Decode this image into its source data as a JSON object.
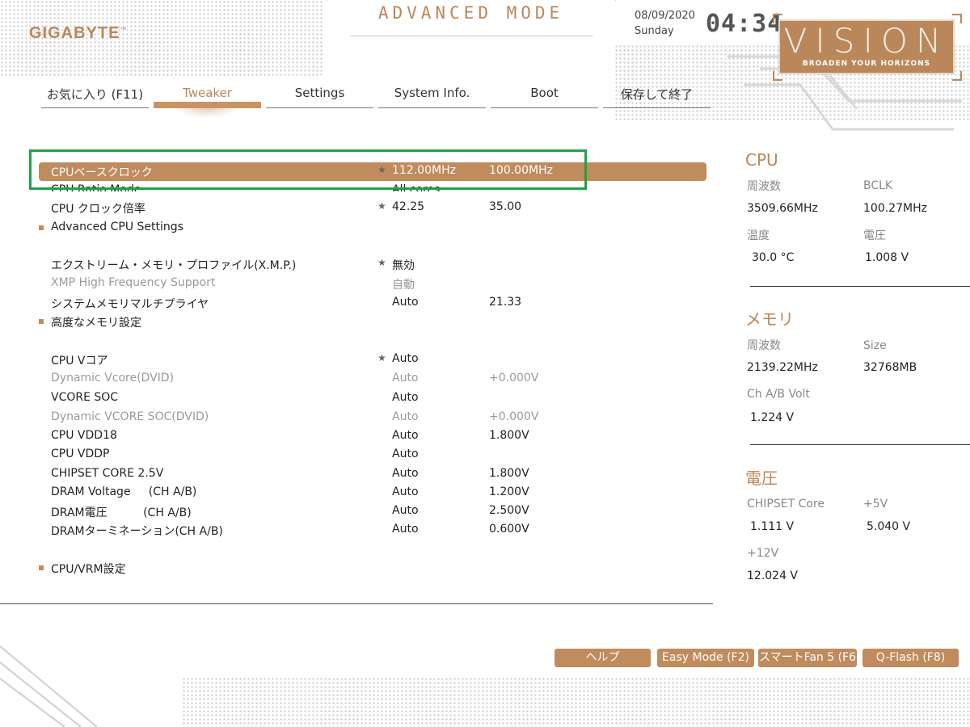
{
  "header": {
    "logo": "GIGABYTE",
    "mode": "ADVANCED MODE",
    "date": "08/09/2020",
    "day": "Sunday",
    "time": "04:34",
    "vision_title": "VISION",
    "vision_tagline": "BROADEN YOUR HORIZONS"
  },
  "tabs": [
    {
      "label": "お気に入り (F11)",
      "active": false
    },
    {
      "label": "Tweaker",
      "active": true
    },
    {
      "label": "Settings",
      "active": false
    },
    {
      "label": "System Info.",
      "active": false
    },
    {
      "label": "Boot",
      "active": false
    },
    {
      "label": "保存して終了",
      "active": false
    }
  ],
  "settings": [
    {
      "label": "CPUベースクロック",
      "star": "★",
      "v1": "112.00MHz",
      "v2": "100.00MHz",
      "selected": true
    },
    {
      "label": "CPU Ratio Mode",
      "v1": "All cores",
      "v2": ""
    },
    {
      "label": "CPU クロック倍率",
      "star": "★",
      "v1": "42.25",
      "v2": "35.00"
    },
    {
      "label": "Advanced CPU Settings",
      "bullet": true
    },
    {
      "label": "エクストリーム・メモリ・プロファイル(X.M.P.)",
      "star": "★",
      "v1": "無効",
      "v2": ""
    },
    {
      "label": "XMP High Frequency Support",
      "v1": "自動",
      "v2": "",
      "dim": true
    },
    {
      "label": "システムメモリマルチプライヤ",
      "v1": "Auto",
      "v2": "21.33"
    },
    {
      "label": "高度なメモリ設定",
      "bullet": true
    },
    {
      "label": "CPU Vコア",
      "star": "★",
      "v1": "Auto",
      "v2": ""
    },
    {
      "label": "Dynamic Vcore(DVID)",
      "v1": "Auto",
      "v2": "+0.000V",
      "dim": true
    },
    {
      "label": "VCORE SOC",
      "v1": "Auto",
      "v2": ""
    },
    {
      "label": "Dynamic VCORE SOC(DVID)",
      "v1": "Auto",
      "v2": "+0.000V",
      "dim": true
    },
    {
      "label": "CPU VDD18",
      "v1": "Auto",
      "v2": "1.800V"
    },
    {
      "label": "CPU VDDP",
      "v1": "Auto",
      "v2": ""
    },
    {
      "label": "CHIPSET CORE 2.5V",
      "v1": "Auto",
      "v2": "1.800V"
    },
    {
      "label": "DRAM Voltage     (CH A/B)",
      "v1": "Auto",
      "v2": "1.200V"
    },
    {
      "label": "DRAM電圧          (CH A/B)",
      "v1": "Auto",
      "v2": "2.500V"
    },
    {
      "label": "DRAMターミネーション(CH A/B)",
      "v1": "Auto",
      "v2": "0.600V"
    },
    {
      "label": "CPU/VRM設定",
      "bullet": true
    }
  ],
  "panel": {
    "cpu": {
      "title": "CPU",
      "freq_label": "周波数",
      "freq": "3509.66MHz",
      "bclk_label": "BCLK",
      "bclk": "100.27MHz",
      "temp_label": "温度",
      "temp": "30.0 °C",
      "volt_label": "電圧",
      "volt": "1.008 V"
    },
    "memory": {
      "title": "メモリ",
      "freq_label": "周波数",
      "freq": "2139.22MHz",
      "size_label": "Size",
      "size": "32768MB",
      "chab_label": "Ch A/B Volt",
      "chab": "1.224 V"
    },
    "voltage": {
      "title": "電圧",
      "chipset_label": "CHIPSET Core",
      "chipset": "1.111 V",
      "v5_label": "+5V",
      "v5": "5.040 V",
      "v12_label": "+12V",
      "v12": "12.024 V"
    }
  },
  "buttons": {
    "help": "ヘルプ",
    "easy": "Easy Mode (F2)",
    "fan": "スマートFan 5 (F6",
    "qflash": "Q-Flash (F8)"
  },
  "colors": {
    "accent": "#c08b5d",
    "highlight_box": "#1fa24a"
  }
}
